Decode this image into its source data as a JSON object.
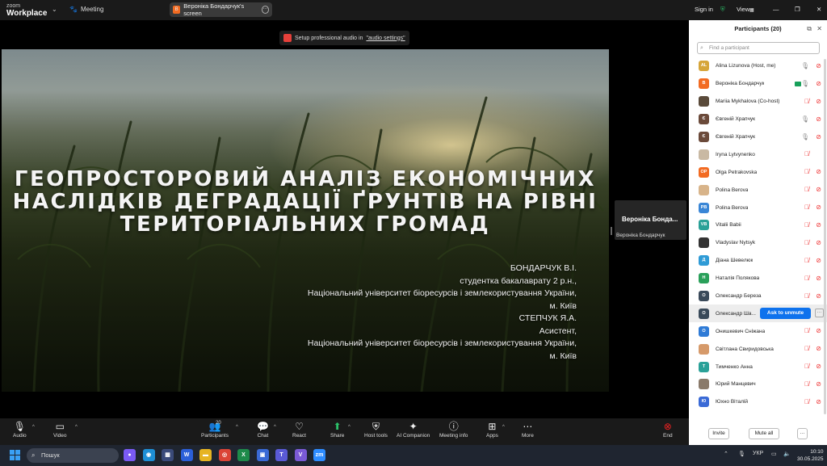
{
  "topbar": {
    "logo_line1": "zoom",
    "logo_line2": "Workplace",
    "meeting_label": "Meeting",
    "screen_tab_label": "Вероніка Бондарчук's screen",
    "signin_label": "Sign in",
    "view_label": "View"
  },
  "banner": {
    "text": "Setup professional audio in ",
    "link": "\"audio settings\""
  },
  "slide": {
    "title_lines": [
      "ГЕОПРОСТОРОВИЙ АНАЛІЗ ЕКОНОМІЧНИХ",
      "НАСЛІДКІВ ДЕГРАДАЦІЇ ҐРУНТІВ НА РІВНІ",
      "ТЕРИТОРІАЛЬНИХ ГРОМАД"
    ],
    "author_lines": [
      "БОНДАРЧУК В.І.",
      "студентка бакалаврату 2 р.н.,",
      "Національний університет біоресурсів і землекористування України,",
      "м. Київ",
      "СТЕПЧУК Я.А.",
      "Асистент,",
      "Національний університет біоресурсів і землекористування України,",
      "м. Київ"
    ]
  },
  "presenter": {
    "name_short": "Вероніка Бонда...",
    "name_full": "Вероніка Бондарчук"
  },
  "toolbar": {
    "audio": "Audio",
    "video": "Video",
    "participants": "Participants",
    "participants_count": "20",
    "chat": "Chat",
    "react": "React",
    "share": "Share",
    "host_tools": "Host tools",
    "ai_companion": "AI Companion",
    "meeting_info": "Meeting info",
    "apps": "Apps",
    "more": "More",
    "end": "End"
  },
  "panel": {
    "title": "Participants (20)",
    "search_placeholder": "Find a participant",
    "ask_to_unmute": "Ask to unmute",
    "invite": "Invite",
    "mute_all": "Mute all",
    "participants": [
      {
        "name": "Alina Lizunova (Host, me)",
        "initials": "AL",
        "color": "#d6a53a",
        "mic": "on",
        "video": "off"
      },
      {
        "name": "Вероніка Бондарчук",
        "initials": "В",
        "color": "#f26b22",
        "mic": "on",
        "video": "on"
      },
      {
        "name": "Mariia Mykhalova (Co-host)",
        "initials": "",
        "color": "#5a4a3a",
        "mic": "off",
        "video": "off"
      },
      {
        "name": "Євгеній Храпчук",
        "initials": "Є",
        "color": "#6b4a3a",
        "mic": "on",
        "video": "off"
      },
      {
        "name": "Євгеній Храпчук",
        "initials": "Є",
        "color": "#6b4a3a",
        "mic": "on",
        "video": "off"
      },
      {
        "name": "Iryna Lytvynenko",
        "initials": "",
        "color": "#c9b9a3",
        "mic": "off",
        "video": "none"
      },
      {
        "name": "Olga Petrakovska",
        "initials": "OP",
        "color": "#f26b22",
        "mic": "off",
        "video": "off"
      },
      {
        "name": "Polina Berova",
        "initials": "",
        "color": "#d8b48a",
        "mic": "off",
        "video": "off"
      },
      {
        "name": "Polina Berova",
        "initials": "PB",
        "color": "#3a86d6",
        "mic": "off",
        "video": "off"
      },
      {
        "name": "Vitalii Babii",
        "initials": "VB",
        "color": "#2aa198",
        "mic": "off",
        "video": "off"
      },
      {
        "name": "Vladyslav Nytsyk",
        "initials": "",
        "color": "#333333",
        "mic": "off",
        "video": "off"
      },
      {
        "name": "Діана Шевелюк",
        "initials": "Д",
        "color": "#2f9bd6",
        "mic": "off",
        "video": "off"
      },
      {
        "name": "Наталія Полякова",
        "initials": "Н",
        "color": "#2aa05a",
        "mic": "off",
        "video": "off"
      },
      {
        "name": "Олександр Береза",
        "initials": "О",
        "color": "#3a4a5a",
        "mic": "off",
        "video": "off"
      },
      {
        "name": "Олександр Ша...",
        "initials": "О",
        "color": "#3a4a5a",
        "mic": "",
        "video": "",
        "highlight": true
      },
      {
        "name": "Онишкевич Сніжана",
        "initials": "О",
        "color": "#2f7bd6",
        "mic": "off",
        "video": "off"
      },
      {
        "name": "Світлана Свиридовська",
        "initials": "",
        "color": "#d69a6a",
        "mic": "off",
        "video": "off"
      },
      {
        "name": "Тимченко Анна",
        "initials": "Т",
        "color": "#2aa198",
        "mic": "off",
        "video": "off"
      },
      {
        "name": "Юрий Манцевич",
        "initials": "",
        "color": "#8a7a6a",
        "mic": "off",
        "video": "off"
      },
      {
        "name": "Юхно Віталій",
        "initials": "Ю",
        "color": "#3a6ad6",
        "mic": "off",
        "video": "off"
      }
    ]
  },
  "taskbar": {
    "search_label": "Пошук",
    "lang": "УКР",
    "time": "10:10",
    "date": "30.05.2025",
    "apps": [
      {
        "glyph": "●",
        "color": "#7a5af5"
      },
      {
        "glyph": "◉",
        "color": "#1e8fd6"
      },
      {
        "glyph": "▦",
        "color": "#3a4a7a"
      },
      {
        "glyph": "W",
        "color": "#2b5fd9"
      },
      {
        "glyph": "▬",
        "color": "#e6b422"
      },
      {
        "glyph": "◎",
        "color": "#db4437"
      },
      {
        "glyph": "X",
        "color": "#1e8a4a"
      },
      {
        "glyph": "▣",
        "color": "#3a6ad6"
      },
      {
        "glyph": "T",
        "color": "#5a5ad6"
      },
      {
        "glyph": "V",
        "color": "#7a5ad6"
      },
      {
        "glyph": "zm",
        "color": "#2d8cff"
      }
    ]
  },
  "colors": {
    "accent": "#0e72ed",
    "end": "#e22222",
    "toolbar_bg": "#1a1a1a"
  }
}
